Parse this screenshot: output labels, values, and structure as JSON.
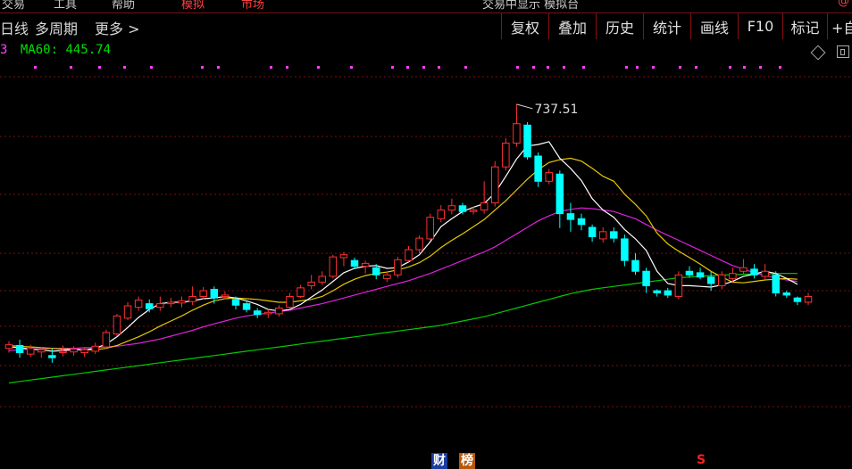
{
  "top_strip": {
    "items": [
      "交易",
      "工具",
      "帮助",
      "模拟",
      "市场"
    ],
    "center": "交易中显示 模拟台",
    "right": "@"
  },
  "toolbar": {
    "left": [
      "日线",
      "多周期",
      "更多 >"
    ],
    "right": [
      "复权",
      "叠加",
      "历史",
      "统计",
      "画线",
      "F10",
      "标记",
      "+自"
    ]
  },
  "ma": {
    "prefix": "3",
    "label": "MA60: 445.74",
    "color": "#00e000"
  },
  "chart": {
    "high_label": "737.51"
  },
  "badges": {
    "cai": "财",
    "bang": "榜",
    "sig": "S"
  },
  "icons": [
    "diamond-icon",
    "layout-icon"
  ],
  "chart_data": {
    "type": "candlestick",
    "ylim": [
      280,
      800
    ],
    "candles": [
      {
        "o": 398,
        "c": 403,
        "h": 408,
        "l": 392
      },
      {
        "o": 402,
        "c": 392,
        "h": 410,
        "l": 385
      },
      {
        "o": 390,
        "c": 398,
        "h": 403,
        "l": 386
      },
      {
        "o": 393,
        "c": 396,
        "h": 400,
        "l": 385
      },
      {
        "o": 388,
        "c": 385,
        "h": 398,
        "l": 378
      },
      {
        "o": 392,
        "c": 394,
        "h": 402,
        "l": 387
      },
      {
        "o": 393,
        "c": 397,
        "h": 401,
        "l": 388
      },
      {
        "o": 392,
        "c": 396,
        "h": 400,
        "l": 386
      },
      {
        "o": 394,
        "c": 401,
        "h": 406,
        "l": 390
      },
      {
        "o": 400,
        "c": 420,
        "h": 424,
        "l": 398
      },
      {
        "o": 418,
        "c": 443,
        "h": 446,
        "l": 415
      },
      {
        "o": 440,
        "c": 457,
        "h": 462,
        "l": 437
      },
      {
        "o": 455,
        "c": 465,
        "h": 470,
        "l": 450
      },
      {
        "o": 460,
        "c": 453,
        "h": 466,
        "l": 448
      },
      {
        "o": 455,
        "c": 460,
        "h": 470,
        "l": 450
      },
      {
        "o": 460,
        "c": 462,
        "h": 468,
        "l": 455
      },
      {
        "o": 461,
        "c": 464,
        "h": 470,
        "l": 455
      },
      {
        "o": 463,
        "c": 470,
        "h": 484,
        "l": 458
      },
      {
        "o": 470,
        "c": 478,
        "h": 483,
        "l": 466
      },
      {
        "o": 480,
        "c": 468,
        "h": 484,
        "l": 460
      },
      {
        "o": 470,
        "c": 472,
        "h": 477,
        "l": 466
      },
      {
        "o": 466,
        "c": 458,
        "h": 470,
        "l": 452
      },
      {
        "o": 460,
        "c": 452,
        "h": 464,
        "l": 448
      },
      {
        "o": 450,
        "c": 445,
        "h": 454,
        "l": 440
      },
      {
        "o": 446,
        "c": 448,
        "h": 452,
        "l": 440
      },
      {
        "o": 446,
        "c": 454,
        "h": 458,
        "l": 442
      },
      {
        "o": 455,
        "c": 470,
        "h": 475,
        "l": 452
      },
      {
        "o": 470,
        "c": 482,
        "h": 486,
        "l": 468
      },
      {
        "o": 485,
        "c": 490,
        "h": 500,
        "l": 480
      },
      {
        "o": 490,
        "c": 498,
        "h": 505,
        "l": 486
      },
      {
        "o": 498,
        "c": 525,
        "h": 528,
        "l": 495
      },
      {
        "o": 524,
        "c": 528,
        "h": 532,
        "l": 512
      },
      {
        "o": 520,
        "c": 512,
        "h": 524,
        "l": 508
      },
      {
        "o": 512,
        "c": 516,
        "h": 520,
        "l": 502
      },
      {
        "o": 510,
        "c": 500,
        "h": 515,
        "l": 494
      },
      {
        "o": 495,
        "c": 500,
        "h": 505,
        "l": 490
      },
      {
        "o": 500,
        "c": 521,
        "h": 525,
        "l": 496
      },
      {
        "o": 520,
        "c": 535,
        "h": 540,
        "l": 518
      },
      {
        "o": 535,
        "c": 551,
        "h": 555,
        "l": 530
      },
      {
        "o": 550,
        "c": 580,
        "h": 585,
        "l": 548
      },
      {
        "o": 578,
        "c": 590,
        "h": 597,
        "l": 573
      },
      {
        "o": 590,
        "c": 596,
        "h": 606,
        "l": 584
      },
      {
        "o": 596,
        "c": 588,
        "h": 600,
        "l": 584
      },
      {
        "o": 588,
        "c": 590,
        "h": 595,
        "l": 584
      },
      {
        "o": 590,
        "c": 600,
        "h": 630,
        "l": 585
      },
      {
        "o": 600,
        "c": 650,
        "h": 658,
        "l": 595
      },
      {
        "o": 650,
        "c": 683,
        "h": 690,
        "l": 645
      },
      {
        "o": 683,
        "c": 710,
        "h": 737,
        "l": 678
      },
      {
        "o": 708,
        "c": 664,
        "h": 712,
        "l": 660
      },
      {
        "o": 665,
        "c": 630,
        "h": 670,
        "l": 622
      },
      {
        "o": 630,
        "c": 642,
        "h": 647,
        "l": 626
      },
      {
        "o": 640,
        "c": 585,
        "h": 645,
        "l": 565
      },
      {
        "o": 585,
        "c": 577,
        "h": 600,
        "l": 560
      },
      {
        "o": 578,
        "c": 570,
        "h": 585,
        "l": 562
      },
      {
        "o": 566,
        "c": 553,
        "h": 570,
        "l": 546
      },
      {
        "o": 550,
        "c": 560,
        "h": 566,
        "l": 545
      },
      {
        "o": 560,
        "c": 551,
        "h": 566,
        "l": 545
      },
      {
        "o": 550,
        "c": 520,
        "h": 556,
        "l": 512
      },
      {
        "o": 520,
        "c": 505,
        "h": 530,
        "l": 500
      },
      {
        "o": 505,
        "c": 485,
        "h": 510,
        "l": 475
      },
      {
        "o": 478,
        "c": 475,
        "h": 480,
        "l": 470
      },
      {
        "o": 478,
        "c": 472,
        "h": 482,
        "l": 468
      },
      {
        "o": 470,
        "c": 500,
        "h": 505,
        "l": 466
      },
      {
        "o": 505,
        "c": 500,
        "h": 512,
        "l": 496
      },
      {
        "o": 503,
        "c": 497,
        "h": 510,
        "l": 494
      },
      {
        "o": 497,
        "c": 488,
        "h": 505,
        "l": 478
      },
      {
        "o": 485,
        "c": 500,
        "h": 505,
        "l": 480
      },
      {
        "o": 495,
        "c": 502,
        "h": 510,
        "l": 490
      },
      {
        "o": 505,
        "c": 510,
        "h": 522,
        "l": 500
      },
      {
        "o": 508,
        "c": 500,
        "h": 515,
        "l": 495
      },
      {
        "o": 498,
        "c": 505,
        "h": 515,
        "l": 493
      },
      {
        "o": 500,
        "c": 475,
        "h": 505,
        "l": 470
      },
      {
        "o": 475,
        "c": 472,
        "h": 478,
        "l": 468
      },
      {
        "o": 468,
        "c": 463,
        "h": 470,
        "l": 458
      },
      {
        "o": 462,
        "c": 470,
        "h": 475,
        "l": 458
      }
    ],
    "ma5": [
      400,
      399,
      397,
      396,
      394,
      395,
      396,
      396,
      398,
      404,
      414,
      427,
      441,
      452,
      460,
      462,
      462,
      464,
      467,
      468,
      470,
      468,
      464,
      459,
      452,
      450,
      452,
      459,
      469,
      479,
      491,
      503,
      509,
      512,
      513,
      509,
      510,
      518,
      528,
      546,
      567,
      578,
      588,
      594,
      599,
      614,
      637,
      661,
      679,
      681,
      685,
      662,
      648,
      631,
      606,
      590,
      580,
      563,
      550,
      534,
      505,
      488,
      485,
      485,
      484,
      483,
      486,
      491,
      498,
      501,
      505,
      502,
      495,
      487
    ],
    "ma10": [
      402,
      401,
      400,
      399,
      398,
      397,
      397,
      396,
      396,
      398,
      402,
      408,
      414,
      421,
      429,
      436,
      443,
      451,
      458,
      464,
      467,
      468,
      467,
      466,
      464,
      462,
      462,
      464,
      466,
      470,
      478,
      487,
      494,
      499,
      502,
      504,
      507,
      511,
      517,
      526,
      538,
      548,
      557,
      567,
      577,
      590,
      603,
      618,
      633,
      646,
      656,
      660,
      662,
      658,
      648,
      637,
      630,
      612,
      598,
      582,
      558,
      543,
      533,
      524,
      515,
      505,
      497,
      490,
      489,
      491,
      493,
      494,
      495,
      494
    ],
    "ma20": [
      395,
      396,
      397,
      397,
      398,
      398,
      398,
      399,
      399,
      400,
      401,
      403,
      405,
      408,
      411,
      415,
      419,
      423,
      428,
      432,
      436,
      440,
      443,
      445,
      447,
      449,
      451,
      454,
      457,
      460,
      464,
      468,
      472,
      476,
      480,
      484,
      488,
      492,
      497,
      502,
      508,
      514,
      520,
      526,
      532,
      539,
      548,
      557,
      566,
      575,
      582,
      588,
      591,
      593,
      592,
      590,
      588,
      583,
      578,
      570,
      562,
      555,
      548,
      541,
      534,
      527,
      520,
      513,
      508,
      503,
      499,
      496,
      493,
      491
    ],
    "ma60": [
      350,
      352,
      354,
      356,
      358,
      360,
      362,
      364,
      366,
      368,
      370,
      372,
      374,
      376,
      378,
      380,
      382,
      384,
      386,
      388,
      390,
      392,
      394,
      396,
      398,
      400,
      402,
      404,
      406,
      408,
      410,
      412,
      414,
      416,
      418,
      420,
      422,
      424,
      426,
      428,
      430,
      433,
      436,
      439,
      442,
      446,
      450,
      454,
      458,
      462,
      466,
      470,
      474,
      477,
      480,
      482,
      484,
      486,
      488,
      490,
      492,
      494,
      496,
      497,
      498,
      499,
      500,
      500,
      501,
      501,
      501,
      502,
      502,
      502
    ]
  }
}
